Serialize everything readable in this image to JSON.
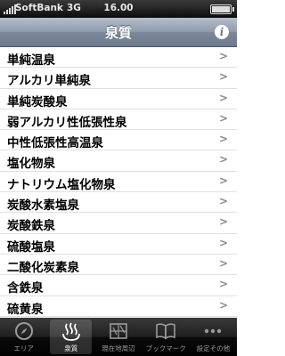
{
  "status_bar": {
    "carrier": "SoftBank",
    "network": "3G",
    "time": "16.00"
  },
  "nav": {
    "title": "泉質",
    "info_symbol": "i"
  },
  "list": {
    "items": [
      "単純温泉",
      "アルカリ単純泉",
      "単純炭酸泉",
      "弱アルカリ性低張性泉",
      "中性低張性高温泉",
      "塩化物泉",
      "ナトリウム塩化物泉",
      "炭酸水素塩泉",
      "炭酸鉄泉",
      "硫酸塩泉",
      "二酸化炭素泉",
      "含鉄泉",
      "硫黄泉"
    ],
    "chevron": ">"
  },
  "tabs": [
    {
      "label": "エリア",
      "icon": "compass-icon",
      "active": false
    },
    {
      "label": "泉質",
      "icon": "hot-spring-icon",
      "active": true
    },
    {
      "label": "現在地周辺",
      "icon": "map-icon",
      "active": false
    },
    {
      "label": "ブックマーク",
      "icon": "book-icon",
      "active": false
    },
    {
      "label": "設定その他",
      "icon": "more-icon",
      "active": false
    }
  ]
}
